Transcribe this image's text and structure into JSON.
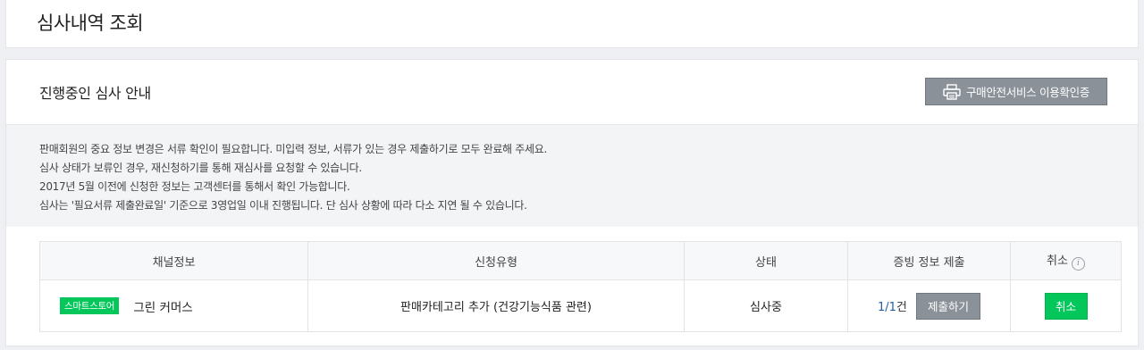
{
  "page": {
    "title": "심사내역 조회"
  },
  "panel": {
    "title": "진행중인 심사 안내",
    "cert_button": {
      "label": "구매안전서비스 이용확인증",
      "icon": "printer-icon"
    }
  },
  "notice": {
    "lines": [
      "판매회원의 중요 정보 변경은 서류 확인이 필요합니다. 미입력 정보, 서류가 있는 경우 제출하기로 모두 완료해 주세요.",
      "심사 상태가 보류인 경우, 재신청하기를 통해 재심사를 요청할 수 있습니다.",
      "2017년 5월 이전에 신청한 정보는 고객센터를 통해서 확인 가능합니다.",
      "심사는 '필요서류 제출완료일' 기준으로 3영업일 이내 진행됩니다. 단 심사 상황에 따라 다소 지연 될 수 있습니다."
    ]
  },
  "table": {
    "headers": {
      "channel": "채널정보",
      "type": "신청유형",
      "status": "상태",
      "proof": "증빙 정보 제출",
      "cancel": "취소"
    },
    "rows": [
      {
        "badge": "스마트스토어",
        "channel_name": "그린 커머스",
        "type": "판매카테고리 추가 (건강기능식품 관련)",
        "status": "심사중",
        "proof_count": "1/1",
        "proof_unit": "건",
        "submit_label": "제출하기",
        "cancel_label": "취소"
      }
    ]
  },
  "colors": {
    "accent_green": "#03c75a",
    "button_gray": "#8b9199",
    "link_blue": "#1f5fa8"
  }
}
